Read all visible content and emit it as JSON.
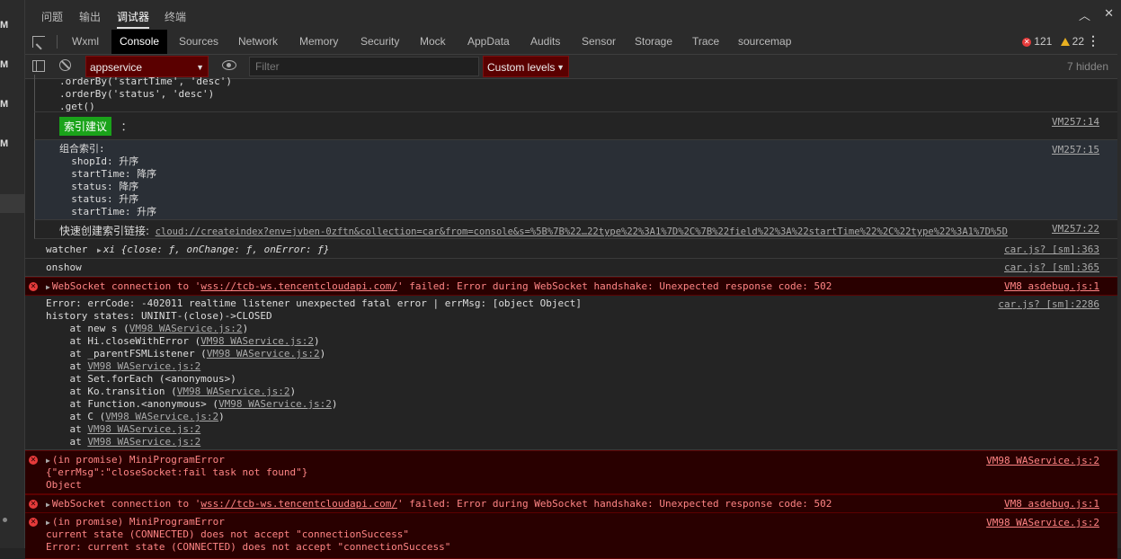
{
  "panel_tabs": [
    "问题",
    "输出",
    "调试器",
    "终端"
  ],
  "gutter_letters": [
    "M",
    "M",
    "M",
    "M"
  ],
  "tabs": [
    "Wxml",
    "Console",
    "Sources",
    "Network",
    "Memory",
    "Security",
    "Mock",
    "AppData",
    "Audits",
    "Sensor",
    "Storage",
    "Trace",
    "sourcemap"
  ],
  "counts": {
    "errors": "121",
    "warnings": "22"
  },
  "toolbar": {
    "context": "appservice",
    "filter_placeholder": "Filter",
    "levels": "Custom levels",
    "hidden": "7 hidden"
  },
  "console": {
    "r1_text": ".orderBy('startTime', 'desc')\n.orderBy('status', 'desc')\n.get()",
    "r2_badge": "索引建议",
    "r2_colon": "：",
    "r2_src": "VM257:14",
    "r3_text": "组合索引:\n  shopId: 升序\n  startTime: 降序\n  status: 降序\n  status: 升序\n  startTime: 升序",
    "r3_src": "VM257:15",
    "r4_label": "快速创建索引链接:",
    "r4_link": "cloud://createindex?env=jvben-0zftn&collection=car&from=console&s=%5B%7B%22…22type%22%3A1%7D%2C%7B%22field%22%3A%22startTime%22%2C%22type%22%3A1%7D%5D",
    "r4_src": "VM257:22",
    "r5_label": "watcher",
    "r5_obj": "xi {close: ƒ, onChange: ƒ, onError: ƒ}",
    "r5_src": "car.js? [sm]:363",
    "r6_text": "onshow",
    "r6_src": "car.js? [sm]:365",
    "r7_pre": "WebSocket connection to '",
    "r7_url": "wss://tcb-ws.tencentcloudapi.com/",
    "r7_post": "' failed: Error during WebSocket handshake: Unexpected response code: 502",
    "r7_src": "VM8 asdebug.js:1",
    "r8_line1": "Error: errCode: -402011 realtime listener unexpected fatal error | errMsg: [object Object]",
    "r8_line2": "history states: UNINIT-(close)->CLOSED",
    "r8_src": "car.js? [sm]:2286",
    "stack": [
      {
        "pre": "    at new s (",
        "link": "VM98 WAService.js:2",
        "post": ")"
      },
      {
        "pre": "    at Hi.closeWithError (",
        "link": "VM98 WAService.js:2",
        "post": ")"
      },
      {
        "pre": "    at _parentFSMListener (",
        "link": "VM98 WAService.js:2",
        "post": ")"
      },
      {
        "pre": "    at ",
        "link": "VM98 WAService.js:2",
        "post": ""
      },
      {
        "pre": "    at Set.forEach (<anonymous>)",
        "link": "",
        "post": ""
      },
      {
        "pre": "    at Ko.transition (",
        "link": "VM98 WAService.js:2",
        "post": ")"
      },
      {
        "pre": "    at Function.<anonymous> (",
        "link": "VM98 WAService.js:2",
        "post": ")"
      },
      {
        "pre": "    at C (",
        "link": "VM98 WAService.js:2",
        "post": ")"
      },
      {
        "pre": "    at ",
        "link": "VM98 WAService.js:2",
        "post": ""
      },
      {
        "pre": "    at ",
        "link": "VM98 WAService.js:2",
        "post": ""
      }
    ],
    "r9_text": "(in promise) MiniProgramError",
    "r9_text2": "{\"errMsg\":\"closeSocket:fail task not found\"}\nObject",
    "r9_src": "VM98 WAService.js:2",
    "r10_src": "VM8 asdebug.js:1",
    "r11_text": "(in promise) MiniProgramError",
    "r11_text2": "current state (CONNECTED) does not accept \"connectionSuccess\"\nError: current state (CONNECTED) does not accept \"connectionSuccess\"",
    "r11_src": "VM98 WAService.js:2"
  }
}
